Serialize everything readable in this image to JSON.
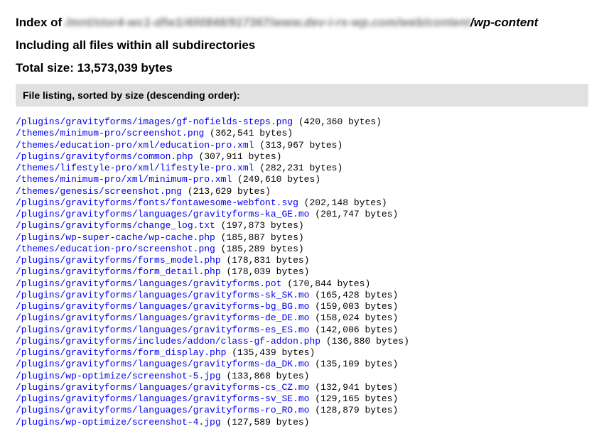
{
  "header": {
    "index_prefix": "Index of ",
    "blurred_middle": "/mnt/stor4-wc1-dfw1/400848/917367/www.dev-i-rs-wp.com/web/content",
    "visible_suffix": "/wp-content",
    "subheading": "Including all files within all subdirectories",
    "total_size_label": "Total size: ",
    "total_size_value": "13,573,039 bytes"
  },
  "listing": {
    "header": "File listing, sorted by size (descending order):",
    "files": [
      {
        "path": "/plugins/gravityforms/images/gf-nofields-steps.png",
        "size": "420,360 bytes"
      },
      {
        "path": "/themes/minimum-pro/screenshot.png",
        "size": "362,541 bytes"
      },
      {
        "path": "/themes/education-pro/xml/education-pro.xml",
        "size": "313,967 bytes"
      },
      {
        "path": "/plugins/gravityforms/common.php",
        "size": "307,911 bytes"
      },
      {
        "path": "/themes/lifestyle-pro/xml/lifestyle-pro.xml",
        "size": "282,231 bytes"
      },
      {
        "path": "/themes/minimum-pro/xml/minimum-pro.xml",
        "size": "249,610 bytes"
      },
      {
        "path": "/themes/genesis/screenshot.png",
        "size": "213,629 bytes"
      },
      {
        "path": "/plugins/gravityforms/fonts/fontawesome-webfont.svg",
        "size": "202,148 bytes"
      },
      {
        "path": "/plugins/gravityforms/languages/gravityforms-ka_GE.mo",
        "size": "201,747 bytes"
      },
      {
        "path": "/plugins/gravityforms/change_log.txt",
        "size": "197,873 bytes"
      },
      {
        "path": "/plugins/wp-super-cache/wp-cache.php",
        "size": "185,887 bytes"
      },
      {
        "path": "/themes/education-pro/screenshot.png",
        "size": "185,289 bytes"
      },
      {
        "path": "/plugins/gravityforms/forms_model.php",
        "size": "178,831 bytes"
      },
      {
        "path": "/plugins/gravityforms/form_detail.php",
        "size": "178,039 bytes"
      },
      {
        "path": "/plugins/gravityforms/languages/gravityforms.pot",
        "size": "170,844 bytes"
      },
      {
        "path": "/plugins/gravityforms/languages/gravityforms-sk_SK.mo",
        "size": "165,428 bytes"
      },
      {
        "path": "/plugins/gravityforms/languages/gravityforms-bg_BG.mo",
        "size": "159,003 bytes"
      },
      {
        "path": "/plugins/gravityforms/languages/gravityforms-de_DE.mo",
        "size": "158,024 bytes"
      },
      {
        "path": "/plugins/gravityforms/languages/gravityforms-es_ES.mo",
        "size": "142,006 bytes"
      },
      {
        "path": "/plugins/gravityforms/includes/addon/class-gf-addon.php",
        "size": "136,880 bytes"
      },
      {
        "path": "/plugins/gravityforms/form_display.php",
        "size": "135,439 bytes"
      },
      {
        "path": "/plugins/gravityforms/languages/gravityforms-da_DK.mo",
        "size": "135,109 bytes"
      },
      {
        "path": "/plugins/wp-optimize/screenshot-5.jpg",
        "size": "133,868 bytes"
      },
      {
        "path": "/plugins/gravityforms/languages/gravityforms-cs_CZ.mo",
        "size": "132,941 bytes"
      },
      {
        "path": "/plugins/gravityforms/languages/gravityforms-sv_SE.mo",
        "size": "129,165 bytes"
      },
      {
        "path": "/plugins/gravityforms/languages/gravityforms-ro_RO.mo",
        "size": "128,879 bytes"
      },
      {
        "path": "/plugins/wp-optimize/screenshot-4.jpg",
        "size": "127,589 bytes"
      }
    ]
  }
}
